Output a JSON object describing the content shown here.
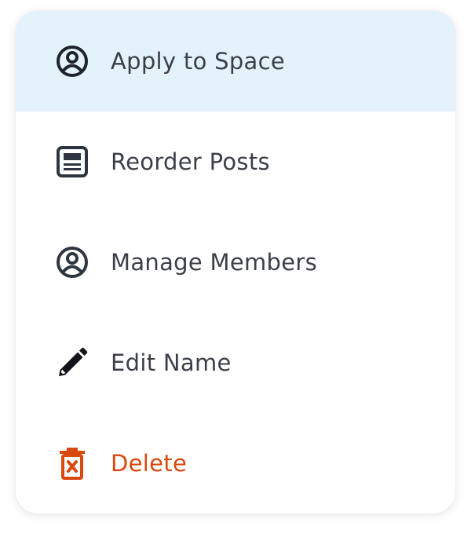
{
  "menu": {
    "items": [
      {
        "label": "Apply to Space",
        "icon": "account-circle-icon",
        "state": "highlighted"
      },
      {
        "label": "Reorder Posts",
        "icon": "article-icon"
      },
      {
        "label": "Manage Members",
        "icon": "account-circle-icon"
      },
      {
        "label": "Edit Name",
        "icon": "pencil-icon"
      },
      {
        "label": "Delete",
        "icon": "trash-icon",
        "variant": "danger"
      }
    ]
  },
  "colors": {
    "highlight_bg": "#e4f2fb",
    "text": "#3b3f48",
    "icon": "#2f3540",
    "danger": "#d9480f"
  }
}
